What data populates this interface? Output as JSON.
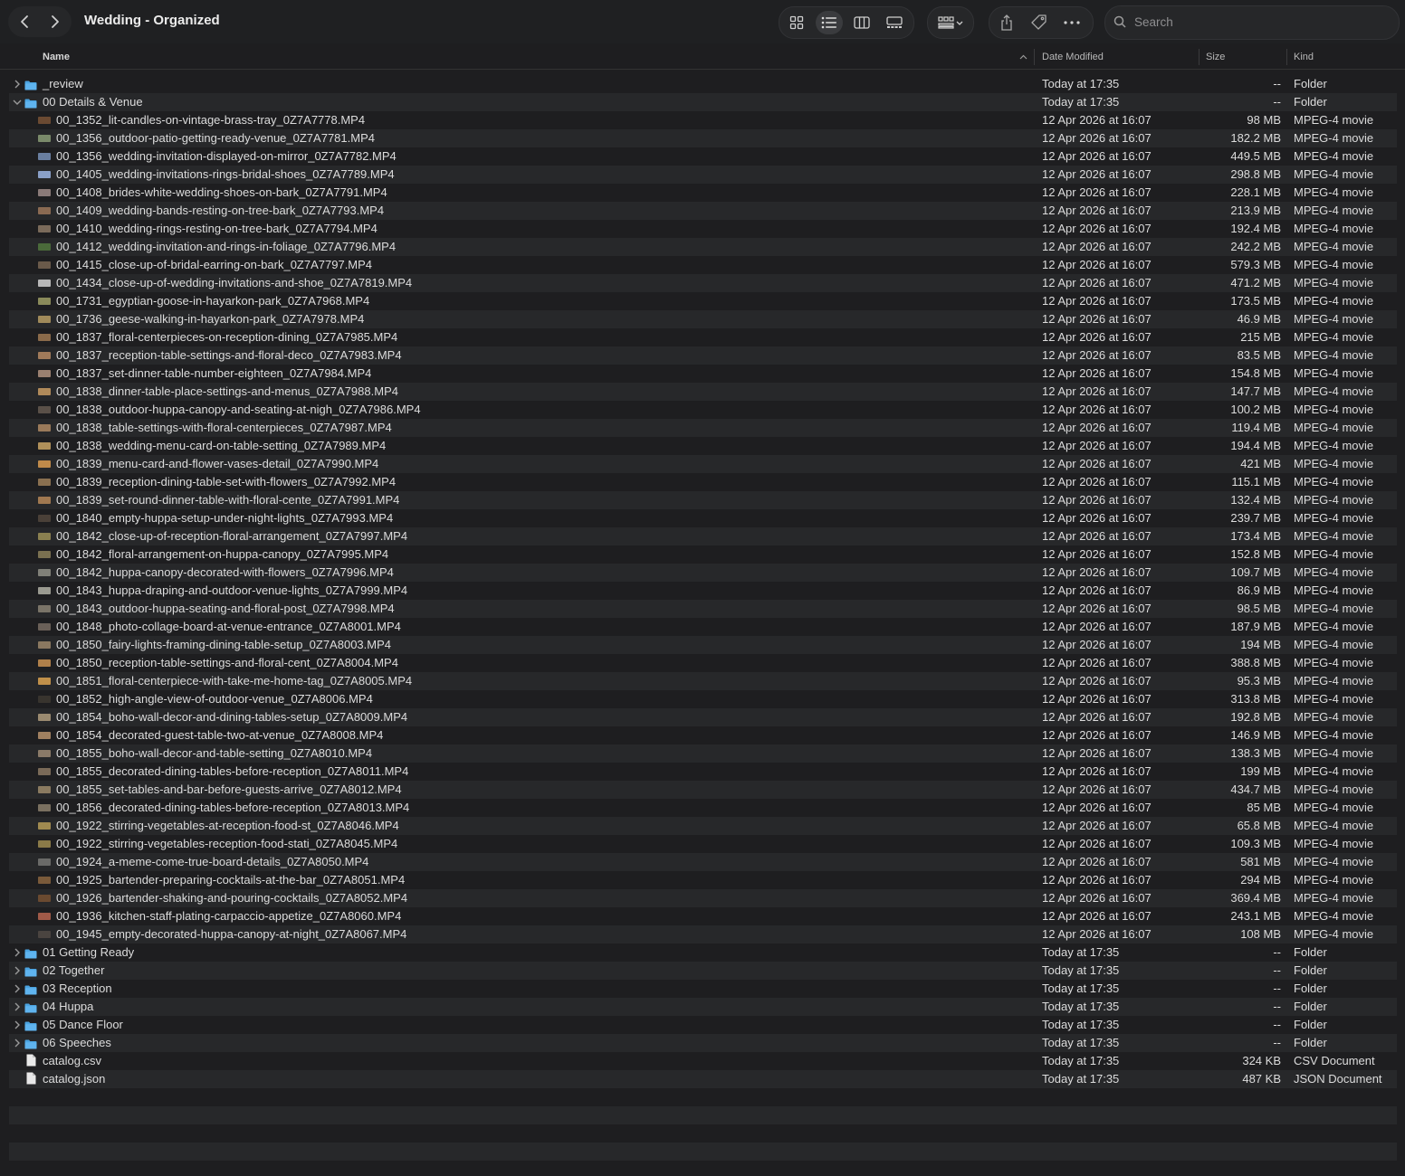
{
  "window": {
    "title": "Wedding - Organized",
    "search_placeholder": "Search"
  },
  "toolbar_icons": [
    "chevron-left-icon",
    "chevron-right-icon",
    "icon-view-icon",
    "list-view-icon",
    "column-view-icon",
    "gallery-view-icon",
    "group-icon",
    "share-icon",
    "tag-icon",
    "more-icon",
    "search-icon"
  ],
  "columns": {
    "name": "Name",
    "date": "Date Modified",
    "size": "Size",
    "kind": "Kind"
  },
  "colors": {
    "folder": "#4aa3e0",
    "alt_row": "#27282a",
    "background": "#1e1e20"
  },
  "rows": [
    {
      "type": "folder",
      "expanded": false,
      "name": "_review",
      "date": "Today at 17:35",
      "size": "--",
      "kind": "Folder"
    },
    {
      "type": "folder",
      "expanded": true,
      "name": "00 Details & Venue",
      "date": "Today at 17:35",
      "size": "--",
      "kind": "Folder"
    },
    {
      "type": "video",
      "name": "00_1352_lit-candles-on-vintage-brass-tray_0Z7A7778.MP4",
      "date": "12 Apr 2026 at 16:07",
      "size": "98 MB",
      "kind": "MPEG-4 movie",
      "thumb": "#6b4a32"
    },
    {
      "type": "video",
      "name": "00_1356_outdoor-patio-getting-ready-venue_0Z7A7781.MP4",
      "date": "12 Apr 2026 at 16:07",
      "size": "182.2 MB",
      "kind": "MPEG-4 movie",
      "thumb": "#7a8a6a"
    },
    {
      "type": "video",
      "name": "00_1356_wedding-invitation-displayed-on-mirror_0Z7A7782.MP4",
      "date": "12 Apr 2026 at 16:07",
      "size": "449.5 MB",
      "kind": "MPEG-4 movie",
      "thumb": "#6a7fa0"
    },
    {
      "type": "video",
      "name": "00_1405_wedding-invitations-rings-bridal-shoes_0Z7A7789.MP4",
      "date": "12 Apr 2026 at 16:07",
      "size": "298.8 MB",
      "kind": "MPEG-4 movie",
      "thumb": "#8aa0c8"
    },
    {
      "type": "video",
      "name": "00_1408_brides-white-wedding-shoes-on-bark_0Z7A7791.MP4",
      "date": "12 Apr 2026 at 16:07",
      "size": "228.1 MB",
      "kind": "MPEG-4 movie",
      "thumb": "#8a7a78"
    },
    {
      "type": "video",
      "name": "00_1409_wedding-bands-resting-on-tree-bark_0Z7A7793.MP4",
      "date": "12 Apr 2026 at 16:07",
      "size": "213.9 MB",
      "kind": "MPEG-4 movie",
      "thumb": "#8a6a52"
    },
    {
      "type": "video",
      "name": "00_1410_wedding-rings-resting-on-tree-bark_0Z7A7794.MP4",
      "date": "12 Apr 2026 at 16:07",
      "size": "192.4 MB",
      "kind": "MPEG-4 movie",
      "thumb": "#7a6a5a"
    },
    {
      "type": "video",
      "name": "00_1412_wedding-invitation-and-rings-in-foliage_0Z7A7796.MP4",
      "date": "12 Apr 2026 at 16:07",
      "size": "242.2 MB",
      "kind": "MPEG-4 movie",
      "thumb": "#4a6a3a"
    },
    {
      "type": "video",
      "name": "00_1415_close-up-of-bridal-earring-on-bark_0Z7A7797.MP4",
      "date": "12 Apr 2026 at 16:07",
      "size": "579.3 MB",
      "kind": "MPEG-4 movie",
      "thumb": "#6a5a4a"
    },
    {
      "type": "video",
      "name": "00_1434_close-up-of-wedding-invitations-and-shoe_0Z7A7819.MP4",
      "date": "12 Apr 2026 at 16:07",
      "size": "471.2 MB",
      "kind": "MPEG-4 movie",
      "thumb": "#b8b8b8"
    },
    {
      "type": "video",
      "name": "00_1731_egyptian-goose-in-hayarkon-park_0Z7A7968.MP4",
      "date": "12 Apr 2026 at 16:07",
      "size": "173.5 MB",
      "kind": "MPEG-4 movie",
      "thumb": "#8a8a5a"
    },
    {
      "type": "video",
      "name": "00_1736_geese-walking-in-hayarkon-park_0Z7A7978.MP4",
      "date": "12 Apr 2026 at 16:07",
      "size": "46.9 MB",
      "kind": "MPEG-4 movie",
      "thumb": "#a08a5a"
    },
    {
      "type": "video",
      "name": "00_1837_floral-centerpieces-on-reception-dining_0Z7A7985.MP4",
      "date": "12 Apr 2026 at 16:07",
      "size": "215 MB",
      "kind": "MPEG-4 movie",
      "thumb": "#8a6a4a"
    },
    {
      "type": "video",
      "name": "00_1837_reception-table-settings-and-floral-deco_0Z7A7983.MP4",
      "date": "12 Apr 2026 at 16:07",
      "size": "83.5 MB",
      "kind": "MPEG-4 movie",
      "thumb": "#a07a5a"
    },
    {
      "type": "video",
      "name": "00_1837_set-dinner-table-number-eighteen_0Z7A7984.MP4",
      "date": "12 Apr 2026 at 16:07",
      "size": "154.8 MB",
      "kind": "MPEG-4 movie",
      "thumb": "#9a8070"
    },
    {
      "type": "video",
      "name": "00_1838_dinner-table-place-settings-and-menus_0Z7A7988.MP4",
      "date": "12 Apr 2026 at 16:07",
      "size": "147.7 MB",
      "kind": "MPEG-4 movie",
      "thumb": "#b08a5a"
    },
    {
      "type": "video",
      "name": "00_1838_outdoor-huppa-canopy-and-seating-at-nigh_0Z7A7986.MP4",
      "date": "12 Apr 2026 at 16:07",
      "size": "100.2 MB",
      "kind": "MPEG-4 movie",
      "thumb": "#5a5048"
    },
    {
      "type": "video",
      "name": "00_1838_table-settings-with-floral-centerpieces_0Z7A7987.MP4",
      "date": "12 Apr 2026 at 16:07",
      "size": "119.4 MB",
      "kind": "MPEG-4 movie",
      "thumb": "#9a7a5a"
    },
    {
      "type": "video",
      "name": "00_1838_wedding-menu-card-on-table-setting_0Z7A7989.MP4",
      "date": "12 Apr 2026 at 16:07",
      "size": "194.4 MB",
      "kind": "MPEG-4 movie",
      "thumb": "#b0905a"
    },
    {
      "type": "video",
      "name": "00_1839_menu-card-and-flower-vases-detail_0Z7A7990.MP4",
      "date": "12 Apr 2026 at 16:07",
      "size": "421 MB",
      "kind": "MPEG-4 movie",
      "thumb": "#c08a4a"
    },
    {
      "type": "video",
      "name": "00_1839_reception-dining-table-set-with-flowers_0Z7A7992.MP4",
      "date": "12 Apr 2026 at 16:07",
      "size": "115.1 MB",
      "kind": "MPEG-4 movie",
      "thumb": "#8a7050"
    },
    {
      "type": "video",
      "name": "00_1839_set-round-dinner-table-with-floral-cente_0Z7A7991.MP4",
      "date": "12 Apr 2026 at 16:07",
      "size": "132.4 MB",
      "kind": "MPEG-4 movie",
      "thumb": "#a07850"
    },
    {
      "type": "video",
      "name": "00_1840_empty-huppa-setup-under-night-lights_0Z7A7993.MP4",
      "date": "12 Apr 2026 at 16:07",
      "size": "239.7 MB",
      "kind": "MPEG-4 movie",
      "thumb": "#4a4038"
    },
    {
      "type": "video",
      "name": "00_1842_close-up-of-reception-floral-arrangement_0Z7A7997.MP4",
      "date": "12 Apr 2026 at 16:07",
      "size": "173.4 MB",
      "kind": "MPEG-4 movie",
      "thumb": "#8a8050"
    },
    {
      "type": "video",
      "name": "00_1842_floral-arrangement-on-huppa-canopy_0Z7A7995.MP4",
      "date": "12 Apr 2026 at 16:07",
      "size": "152.8 MB",
      "kind": "MPEG-4 movie",
      "thumb": "#7a7050"
    },
    {
      "type": "video",
      "name": "00_1842_huppa-canopy-decorated-with-flowers_0Z7A7996.MP4",
      "date": "12 Apr 2026 at 16:07",
      "size": "109.7 MB",
      "kind": "MPEG-4 movie",
      "thumb": "#808078"
    },
    {
      "type": "video",
      "name": "00_1843_huppa-draping-and-outdoor-venue-lights_0Z7A7999.MP4",
      "date": "12 Apr 2026 at 16:07",
      "size": "86.9 MB",
      "kind": "MPEG-4 movie",
      "thumb": "#9a9a90"
    },
    {
      "type": "video",
      "name": "00_1843_outdoor-huppa-seating-and-floral-post_0Z7A7998.MP4",
      "date": "12 Apr 2026 at 16:07",
      "size": "98.5 MB",
      "kind": "MPEG-4 movie",
      "thumb": "#7a7468"
    },
    {
      "type": "video",
      "name": "00_1848_photo-collage-board-at-venue-entrance_0Z7A8001.MP4",
      "date": "12 Apr 2026 at 16:07",
      "size": "187.9 MB",
      "kind": "MPEG-4 movie",
      "thumb": "#6a6058"
    },
    {
      "type": "video",
      "name": "00_1850_fairy-lights-framing-dining-table-setup_0Z7A8003.MP4",
      "date": "12 Apr 2026 at 16:07",
      "size": "194 MB",
      "kind": "MPEG-4 movie",
      "thumb": "#8a7860"
    },
    {
      "type": "video",
      "name": "00_1850_reception-table-settings-and-floral-cent_0Z7A8004.MP4",
      "date": "12 Apr 2026 at 16:07",
      "size": "388.8 MB",
      "kind": "MPEG-4 movie",
      "thumb": "#b0804a"
    },
    {
      "type": "video",
      "name": "00_1851_floral-centerpiece-with-take-me-home-tag_0Z7A8005.MP4",
      "date": "12 Apr 2026 at 16:07",
      "size": "95.3 MB",
      "kind": "MPEG-4 movie",
      "thumb": "#c0904a"
    },
    {
      "type": "video",
      "name": "00_1852_high-angle-view-of-outdoor-venue_0Z7A8006.MP4",
      "date": "12 Apr 2026 at 16:07",
      "size": "313.8 MB",
      "kind": "MPEG-4 movie",
      "thumb": "#38342e"
    },
    {
      "type": "video",
      "name": "00_1854_boho-wall-decor-and-dining-tables-setup_0Z7A8009.MP4",
      "date": "12 Apr 2026 at 16:07",
      "size": "192.8 MB",
      "kind": "MPEG-4 movie",
      "thumb": "#9a8a70"
    },
    {
      "type": "video",
      "name": "00_1854_decorated-guest-table-two-at-venue_0Z7A8008.MP4",
      "date": "12 Apr 2026 at 16:07",
      "size": "146.9 MB",
      "kind": "MPEG-4 movie",
      "thumb": "#a08060"
    },
    {
      "type": "video",
      "name": "00_1855_boho-wall-decor-and-table-setting_0Z7A8010.MP4",
      "date": "12 Apr 2026 at 16:07",
      "size": "138.3 MB",
      "kind": "MPEG-4 movie",
      "thumb": "#8a7a68"
    },
    {
      "type": "video",
      "name": "00_1855_decorated-dining-tables-before-reception_0Z7A8011.MP4",
      "date": "12 Apr 2026 at 16:07",
      "size": "199 MB",
      "kind": "MPEG-4 movie",
      "thumb": "#7a6a58"
    },
    {
      "type": "video",
      "name": "00_1855_set-tables-and-bar-before-guests-arrive_0Z7A8012.MP4",
      "date": "12 Apr 2026 at 16:07",
      "size": "434.7 MB",
      "kind": "MPEG-4 movie",
      "thumb": "#8a7a60"
    },
    {
      "type": "video",
      "name": "00_1856_decorated-dining-tables-before-reception_0Z7A8013.MP4",
      "date": "12 Apr 2026 at 16:07",
      "size": "85 MB",
      "kind": "MPEG-4 movie",
      "thumb": "#7a7060"
    },
    {
      "type": "video",
      "name": "00_1922_stirring-vegetables-at-reception-food-st_0Z7A8046.MP4",
      "date": "12 Apr 2026 at 16:07",
      "size": "65.8 MB",
      "kind": "MPEG-4 movie",
      "thumb": "#a08a50"
    },
    {
      "type": "video",
      "name": "00_1922_stirring-vegetables-reception-food-stati_0Z7A8045.MP4",
      "date": "12 Apr 2026 at 16:07",
      "size": "109.3 MB",
      "kind": "MPEG-4 movie",
      "thumb": "#8a7a48"
    },
    {
      "type": "video",
      "name": "00_1924_a-meme-come-true-board-details_0Z7A8050.MP4",
      "date": "12 Apr 2026 at 16:07",
      "size": "581 MB",
      "kind": "MPEG-4 movie",
      "thumb": "#6a6a68"
    },
    {
      "type": "video",
      "name": "00_1925_bartender-preparing-cocktails-at-the-bar_0Z7A8051.MP4",
      "date": "12 Apr 2026 at 16:07",
      "size": "294 MB",
      "kind": "MPEG-4 movie",
      "thumb": "#7a5a3a"
    },
    {
      "type": "video",
      "name": "00_1926_bartender-shaking-and-pouring-cocktails_0Z7A8052.MP4",
      "date": "12 Apr 2026 at 16:07",
      "size": "369.4 MB",
      "kind": "MPEG-4 movie",
      "thumb": "#6a4a30"
    },
    {
      "type": "video",
      "name": "00_1936_kitchen-staff-plating-carpaccio-appetize_0Z7A8060.MP4",
      "date": "12 Apr 2026 at 16:07",
      "size": "243.1 MB",
      "kind": "MPEG-4 movie",
      "thumb": "#a05a48"
    },
    {
      "type": "video",
      "name": "00_1945_empty-decorated-huppa-canopy-at-night_0Z7A8067.MP4",
      "date": "12 Apr 2026 at 16:07",
      "size": "108 MB",
      "kind": "MPEG-4 movie",
      "thumb": "#4a4440"
    },
    {
      "type": "folder",
      "expanded": false,
      "name": "01 Getting Ready",
      "date": "Today at 17:35",
      "size": "--",
      "kind": "Folder"
    },
    {
      "type": "folder",
      "expanded": false,
      "name": "02 Together",
      "date": "Today at 17:35",
      "size": "--",
      "kind": "Folder"
    },
    {
      "type": "folder",
      "expanded": false,
      "name": "03 Reception",
      "date": "Today at 17:35",
      "size": "--",
      "kind": "Folder"
    },
    {
      "type": "folder",
      "expanded": false,
      "name": "04 Huppa",
      "date": "Today at 17:35",
      "size": "--",
      "kind": "Folder"
    },
    {
      "type": "folder",
      "expanded": false,
      "name": "05 Dance Floor",
      "date": "Today at 17:35",
      "size": "--",
      "kind": "Folder"
    },
    {
      "type": "folder",
      "expanded": false,
      "name": "06 Speeches",
      "date": "Today at 17:35",
      "size": "--",
      "kind": "Folder"
    },
    {
      "type": "file",
      "name": "catalog.csv",
      "date": "Today at 17:35",
      "size": "324 KB",
      "kind": "CSV Document"
    },
    {
      "type": "file",
      "name": "catalog.json",
      "date": "Today at 17:35",
      "size": "487 KB",
      "kind": "JSON Document"
    }
  ]
}
